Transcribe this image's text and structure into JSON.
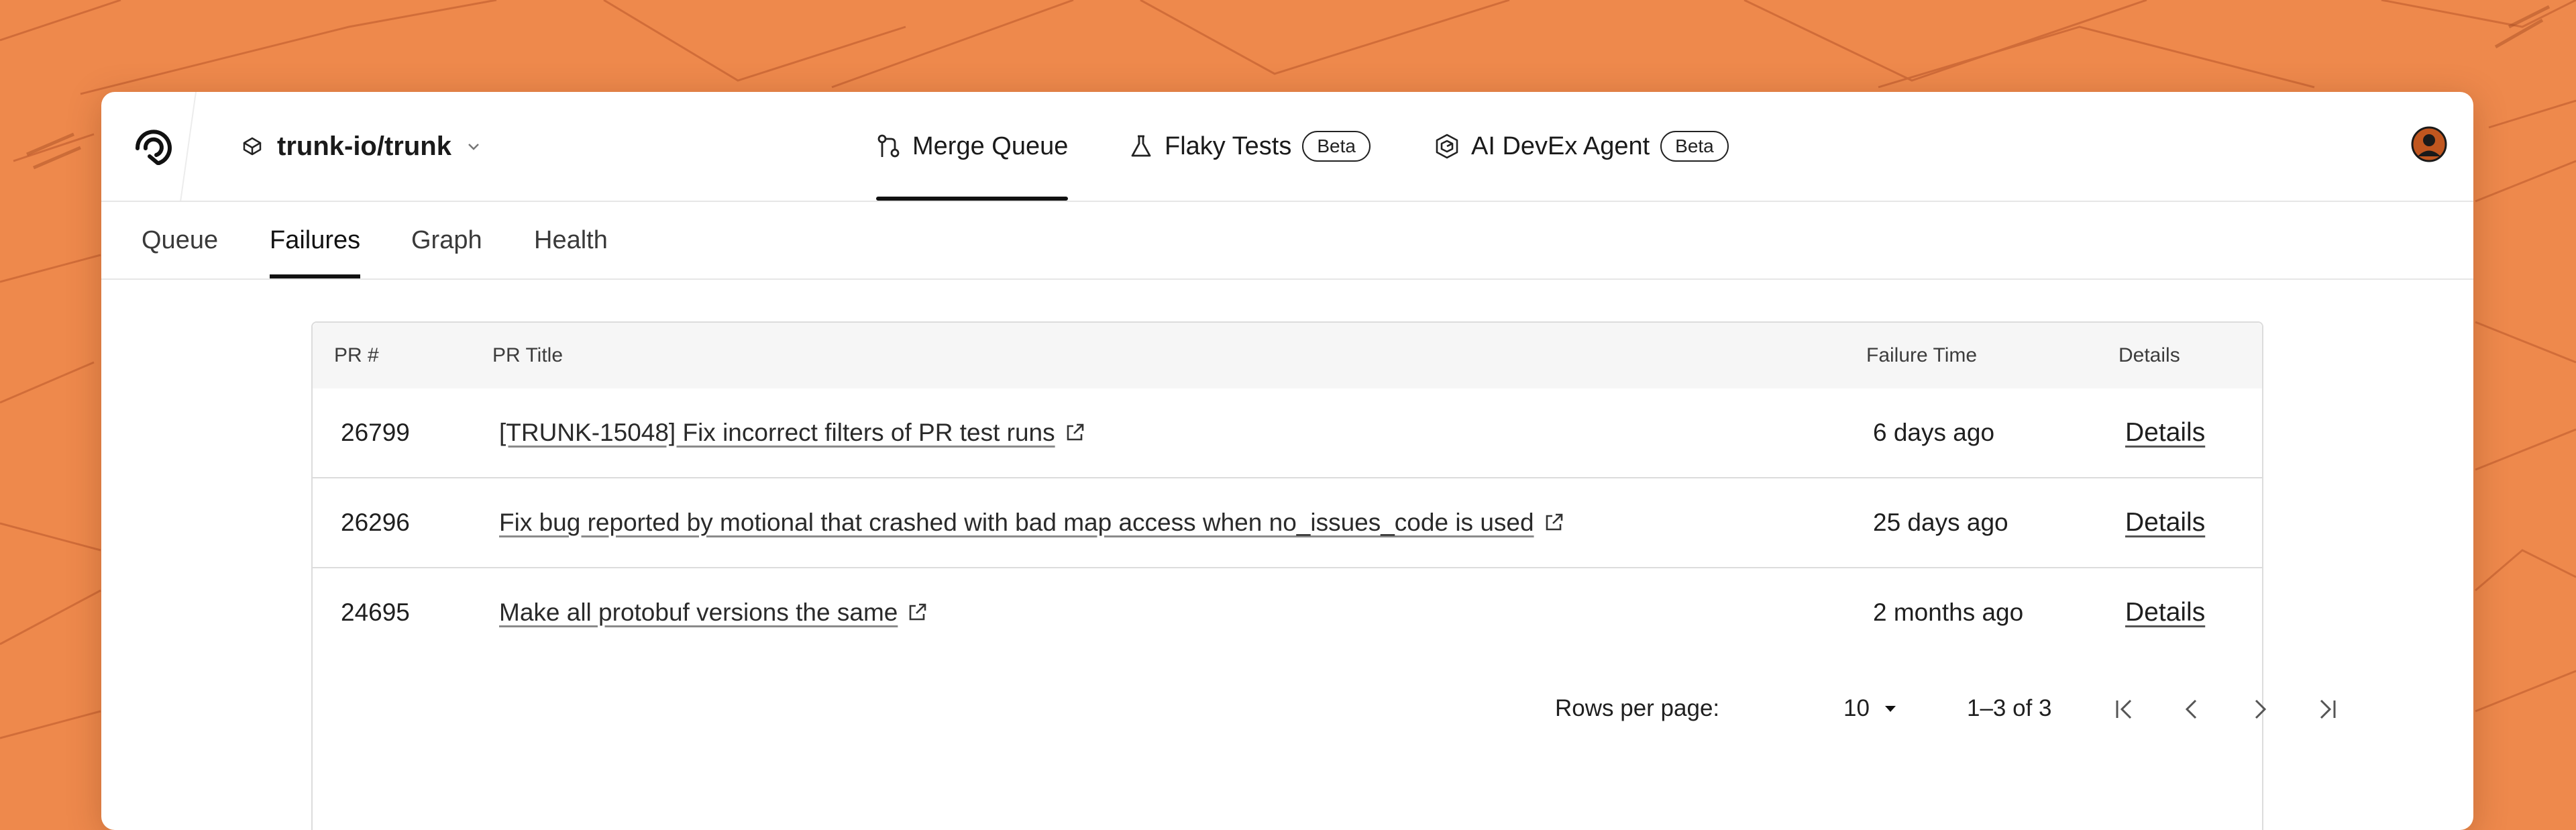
{
  "colors": {
    "background": "#EE894C",
    "accent": "#111111",
    "avatar": "#C0561F"
  },
  "header": {
    "logo_icon": "trunk-logo-icon",
    "repo": {
      "icon": "repo-icon",
      "name": "trunk-io/trunk",
      "dropdown_icon": "chevron-down-icon"
    },
    "nav": [
      {
        "label": "Merge Queue",
        "icon": "merge-icon",
        "badge": "",
        "active": true
      },
      {
        "label": "Flaky Tests",
        "icon": "flask-icon",
        "badge": "Beta",
        "active": false
      },
      {
        "label": "AI DevEx Agent",
        "icon": "agent-icon",
        "badge": "Beta",
        "active": false
      }
    ],
    "avatar_icon": "user-avatar-icon"
  },
  "subtabs": [
    {
      "label": "Queue",
      "active": false
    },
    {
      "label": "Failures",
      "active": true
    },
    {
      "label": "Graph",
      "active": false
    },
    {
      "label": "Health",
      "active": false
    }
  ],
  "table": {
    "columns": [
      "PR #",
      "PR Title",
      "Failure Time",
      "Details"
    ],
    "rows": [
      {
        "pr": "26799",
        "title": "[TRUNK-15048] Fix incorrect filters of PR test runs",
        "time": "6 days ago",
        "details": "Details"
      },
      {
        "pr": "26296",
        "title": "Fix bug reported by motional that crashed with bad map access when no_issues_code is used",
        "time": "25 days ago",
        "details": "Details"
      },
      {
        "pr": "24695",
        "title": "Make all protobuf versions the same",
        "time": "2 months ago",
        "details": "Details"
      }
    ]
  },
  "pagination": {
    "rows_per_page_label": "Rows per page:",
    "rows_per_page_value": "10",
    "range": "1–3 of 3",
    "icons": [
      "first-page-icon",
      "prev-page-icon",
      "next-page-icon",
      "last-page-icon"
    ]
  }
}
